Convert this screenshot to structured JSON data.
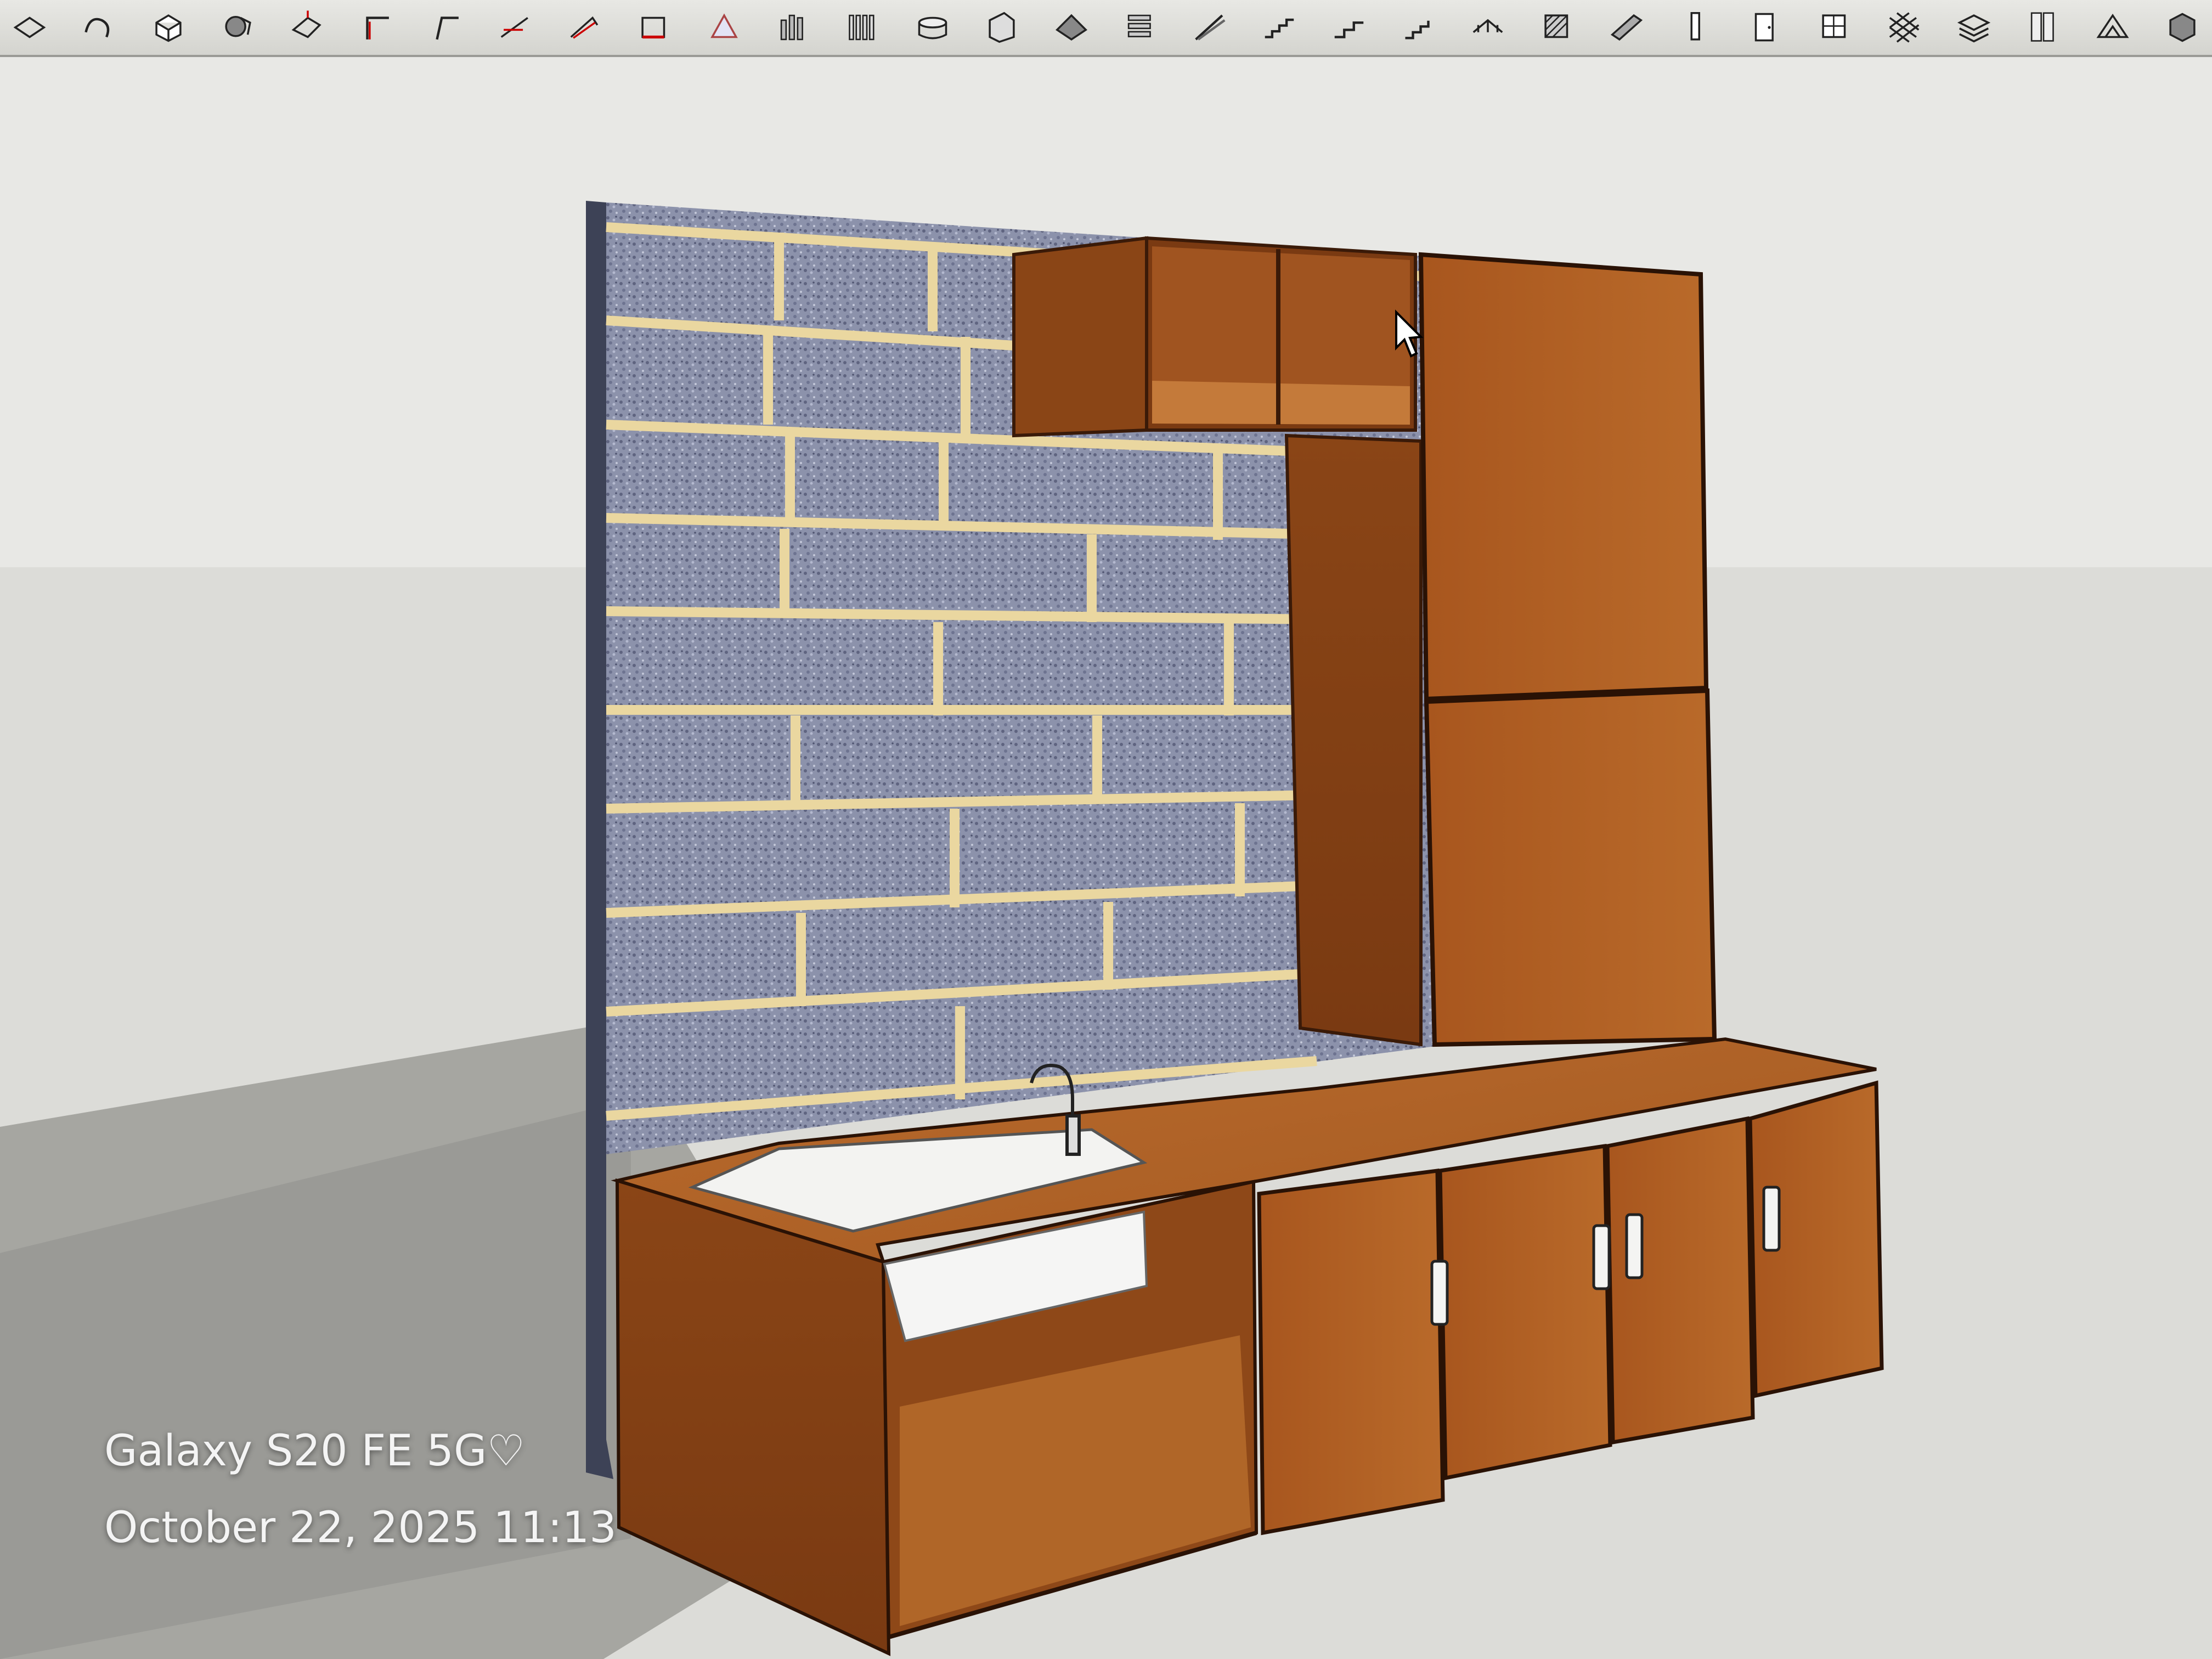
{
  "toolbar": {
    "tools": [
      {
        "icon": "rotate-icon"
      },
      {
        "icon": "follow-me-icon"
      },
      {
        "icon": "box-icon"
      },
      {
        "icon": "solid-union-icon"
      },
      {
        "icon": "push-pull-icon"
      },
      {
        "icon": "offset-line-icon"
      },
      {
        "icon": "corner-line-icon"
      },
      {
        "icon": "line-tool-icon"
      },
      {
        "icon": "extrude-edges-icon"
      },
      {
        "icon": "frame-icon"
      },
      {
        "icon": "triangle-face-icon"
      },
      {
        "icon": "columns-icon"
      },
      {
        "icon": "balusters-icon"
      },
      {
        "icon": "round-tower-icon"
      },
      {
        "icon": "wall-icon"
      },
      {
        "icon": "roof-icon"
      },
      {
        "icon": "stacked-slabs-icon"
      },
      {
        "icon": "ramp-icon"
      },
      {
        "icon": "stair-icon"
      },
      {
        "icon": "stair-landing-icon"
      },
      {
        "icon": "stair-spiral-icon"
      },
      {
        "icon": "railing-icon"
      },
      {
        "icon": "hatch-icon"
      },
      {
        "icon": "beam-icon"
      },
      {
        "icon": "post-icon"
      },
      {
        "icon": "door-icon"
      },
      {
        "icon": "window-icon"
      },
      {
        "icon": "lattice-icon"
      },
      {
        "icon": "layers-icon"
      },
      {
        "icon": "panel-icon"
      },
      {
        "icon": "truss-icon"
      },
      {
        "icon": "component-icon"
      }
    ]
  },
  "watermark": {
    "device": "Galaxy S20 FE 5G♡",
    "datetime": "October 22, 2025 11:13"
  },
  "colors": {
    "wood": "#a85a22",
    "wood_dark": "#6e3512",
    "wood_light": "#c97a36",
    "stone": "#8a90a8",
    "mortar": "#e8d9a0",
    "floor": "#e3e3df",
    "sky": "#e9e9e6"
  }
}
